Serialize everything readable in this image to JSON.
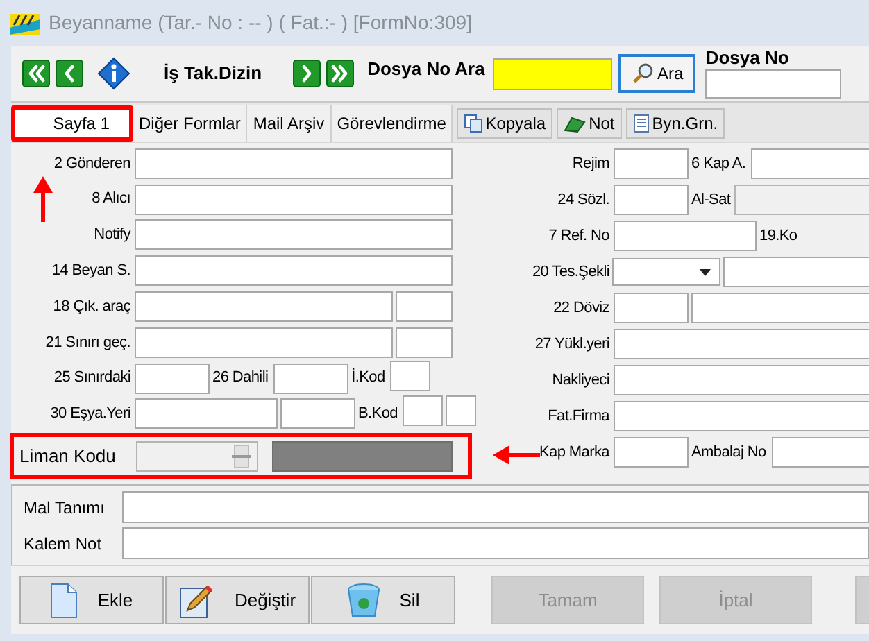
{
  "window": {
    "title": "Beyanname (Tar.- No :  --  ) ( Fat.:- )  [FormNo:309]"
  },
  "toolbar": {
    "label": "İş Tak.Dizin",
    "search_label": "Dosya No Ara",
    "search_button": "Ara",
    "file_label": "Dosya No"
  },
  "tabs": [
    {
      "label": "Sayfa 1",
      "selected": true,
      "highlighted": true
    },
    {
      "label": "Diğer Formlar",
      "selected": false,
      "highlighted": false
    },
    {
      "label": "Mail Arşiv",
      "selected": false,
      "highlighted": false
    },
    {
      "label": "Görevlendirme",
      "selected": false,
      "highlighted": false
    }
  ],
  "tab_actions": [
    {
      "label": "Kopyala",
      "kind": "copy"
    },
    {
      "label": "Not",
      "kind": "note"
    },
    {
      "label": "Byn.Grn.",
      "kind": "doc"
    }
  ],
  "left_rows": [
    {
      "highlighted": false,
      "items": [
        {
          "kind": "label",
          "text": "2 Gönderen"
        },
        {
          "kind": "full"
        }
      ]
    },
    {
      "highlighted": false,
      "items": [
        {
          "kind": "label",
          "text": "8 Alıcı"
        },
        {
          "kind": "full"
        }
      ]
    },
    {
      "highlighted": false,
      "items": [
        {
          "kind": "label",
          "text": "Notify"
        },
        {
          "kind": "full"
        }
      ]
    },
    {
      "highlighted": false,
      "items": [
        {
          "kind": "label",
          "text": "14 Beyan S."
        },
        {
          "kind": "full"
        }
      ]
    },
    {
      "highlighted": false,
      "items": [
        {
          "kind": "label",
          "text": "18 Çık. araç"
        },
        {
          "kind": "wide"
        },
        {
          "kind": "small"
        }
      ]
    },
    {
      "highlighted": false,
      "items": [
        {
          "kind": "label",
          "text": "21 Sınırı geç."
        },
        {
          "kind": "wide"
        },
        {
          "kind": "small"
        }
      ]
    },
    {
      "highlighted": false,
      "items": [
        {
          "kind": "label",
          "text": "25 Sınırdaki"
        },
        {
          "kind": "short"
        },
        {
          "kind": "inline",
          "text": "26 Dahili"
        },
        {
          "kind": "short"
        },
        {
          "kind": "inline",
          "text": "İ.Kod"
        },
        {
          "kind": "tiny"
        }
      ]
    },
    {
      "highlighted": false,
      "items": [
        {
          "kind": "label",
          "text": "30 Eşya.Yeri"
        },
        {
          "kind": "medium"
        },
        {
          "kind": "short"
        },
        {
          "kind": "inline",
          "text": "B.Kod"
        },
        {
          "kind": "tiny"
        },
        {
          "kind": "mini"
        }
      ]
    },
    {
      "highlighted": true,
      "items": [
        {
          "kind": "biglabel",
          "text": "Liman Kodu"
        },
        {
          "kind": "spinner"
        },
        {
          "kind": "bar"
        }
      ]
    }
  ],
  "right_rows": [
    {
      "items": [
        {
          "kind": "label",
          "text": "Rejim"
        },
        {
          "kind": "short"
        },
        {
          "kind": "inline",
          "text": "6 Kap A."
        },
        {
          "kind": "rest"
        }
      ]
    },
    {
      "items": [
        {
          "kind": "label",
          "text": "24 Sözl."
        },
        {
          "kind": "short"
        },
        {
          "kind": "inline",
          "text": "Al-Sat"
        },
        {
          "kind": "disabled"
        }
      ]
    },
    {
      "items": [
        {
          "kind": "label",
          "text": "7 Ref. No"
        },
        {
          "kind": "medium"
        },
        {
          "kind": "inline",
          "text": "19.Ko"
        }
      ]
    },
    {
      "items": [
        {
          "kind": "label",
          "text": "20 Tes.Şekli"
        },
        {
          "kind": "combo"
        },
        {
          "kind": "rest"
        }
      ]
    },
    {
      "items": [
        {
          "kind": "label",
          "text": "22 Döviz"
        },
        {
          "kind": "short"
        },
        {
          "kind": "rest"
        }
      ]
    },
    {
      "items": [
        {
          "kind": "label",
          "text": "27 Yükl.yeri"
        },
        {
          "kind": "rest"
        }
      ]
    },
    {
      "items": [
        {
          "kind": "label",
          "text": "Nakliyeci"
        },
        {
          "kind": "rest"
        }
      ]
    },
    {
      "items": [
        {
          "kind": "label",
          "text": "Fat.Firma"
        },
        {
          "kind": "rest"
        }
      ]
    },
    {
      "items": [
        {
          "kind": "label",
          "text": "Kap Marka"
        },
        {
          "kind": "short"
        },
        {
          "kind": "inline",
          "text": "Ambalaj No"
        },
        {
          "kind": "rest"
        }
      ]
    }
  ],
  "item_fields": [
    {
      "label": "Mal Tanımı"
    },
    {
      "label": "Kalem Not"
    }
  ],
  "buttons": [
    {
      "label": "Ekle",
      "kind": "new",
      "disabled": false
    },
    {
      "label": "Değiştir",
      "kind": "edit",
      "disabled": false
    },
    {
      "label": "Sil",
      "kind": "delete",
      "disabled": false
    },
    {
      "label": "Tamam",
      "kind": "plain",
      "disabled": true
    },
    {
      "label": "İptal",
      "kind": "plain",
      "disabled": true
    },
    {
      "kind": "plain",
      "disabled": true
    }
  ]
}
